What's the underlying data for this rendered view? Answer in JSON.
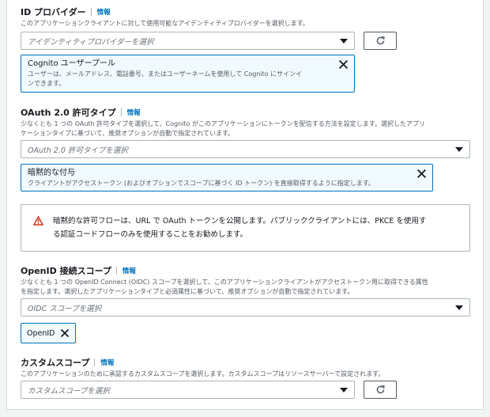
{
  "id_provider": {
    "label": "ID プロバイダー",
    "info": "情報",
    "description": "このアプリケーションクライアントに対して使用可能なアイデンティティプロバイダーを選択します。",
    "select_placeholder": "アイデンティティプロバイダーを選択",
    "token_title": "Cognito ユーザープール",
    "token_desc_1": "ユーザーは、メールアドレス、電話番号、またはユーザーネームを使用して Cognito にサインイ",
    "token_desc_2": "ンできます。"
  },
  "oauth": {
    "label": "OAuth 2.0 許可タイプ",
    "info": "情報",
    "description_1": "少なくとも 1 つの OAuth 許可タイプを選択して、Cognito がこのアプリケーションにトークンを配信する方法を設定します。選択したアプリ",
    "description_2": "ケーションタイプに基づいて、推奨オプションが自動で指定されています。",
    "select_placeholder": "OAuth 2.0 許可タイプを選択",
    "token_title": "暗黙的な付与",
    "token_desc": "クライアントがアクセストークン (およびオプションでスコープに基づく ID トークン) を直接取得するように指定します。"
  },
  "warning": {
    "line1": "暗黙的な許可フローは、URL で OAuth トークンを公開します。パブリッククライアントには、PKCE を使用す",
    "line2": "る認証コードフローのみを使用することをお勧めします。"
  },
  "openid": {
    "label": "OpenID 接続スコープ",
    "info": "情報",
    "description_1": "少なくとも 1 つの OpenID Connect (OIDC) スコープを選択して、このアプリケーションクライアントがアクセストークン用に取得できる属性",
    "description_2": "を指定します。選択したアプリケーションタイプと必須属性に基づいて、推奨オプションが自動で指定されています。",
    "select_placeholder": "OIDC スコープを選択",
    "chip_label": "OpenID"
  },
  "custom_scope": {
    "label": "カスタムスコープ",
    "info": "情報",
    "description": "このアプリケーションのために承認するカスタムスコープを選択します。カスタムスコープはリソースサーバーで設定されます。",
    "select_placeholder": "カスタムスコープを選択"
  },
  "colors": {
    "accent": "#0073bb",
    "token_bg": "#f1faff",
    "warning": "#d13212",
    "text": "#16191f",
    "secondary_text": "#545b64"
  },
  "icons": {
    "refresh": "refresh-icon",
    "close": "close-icon",
    "warning": "warning-icon",
    "caret": "caret-down-icon"
  }
}
